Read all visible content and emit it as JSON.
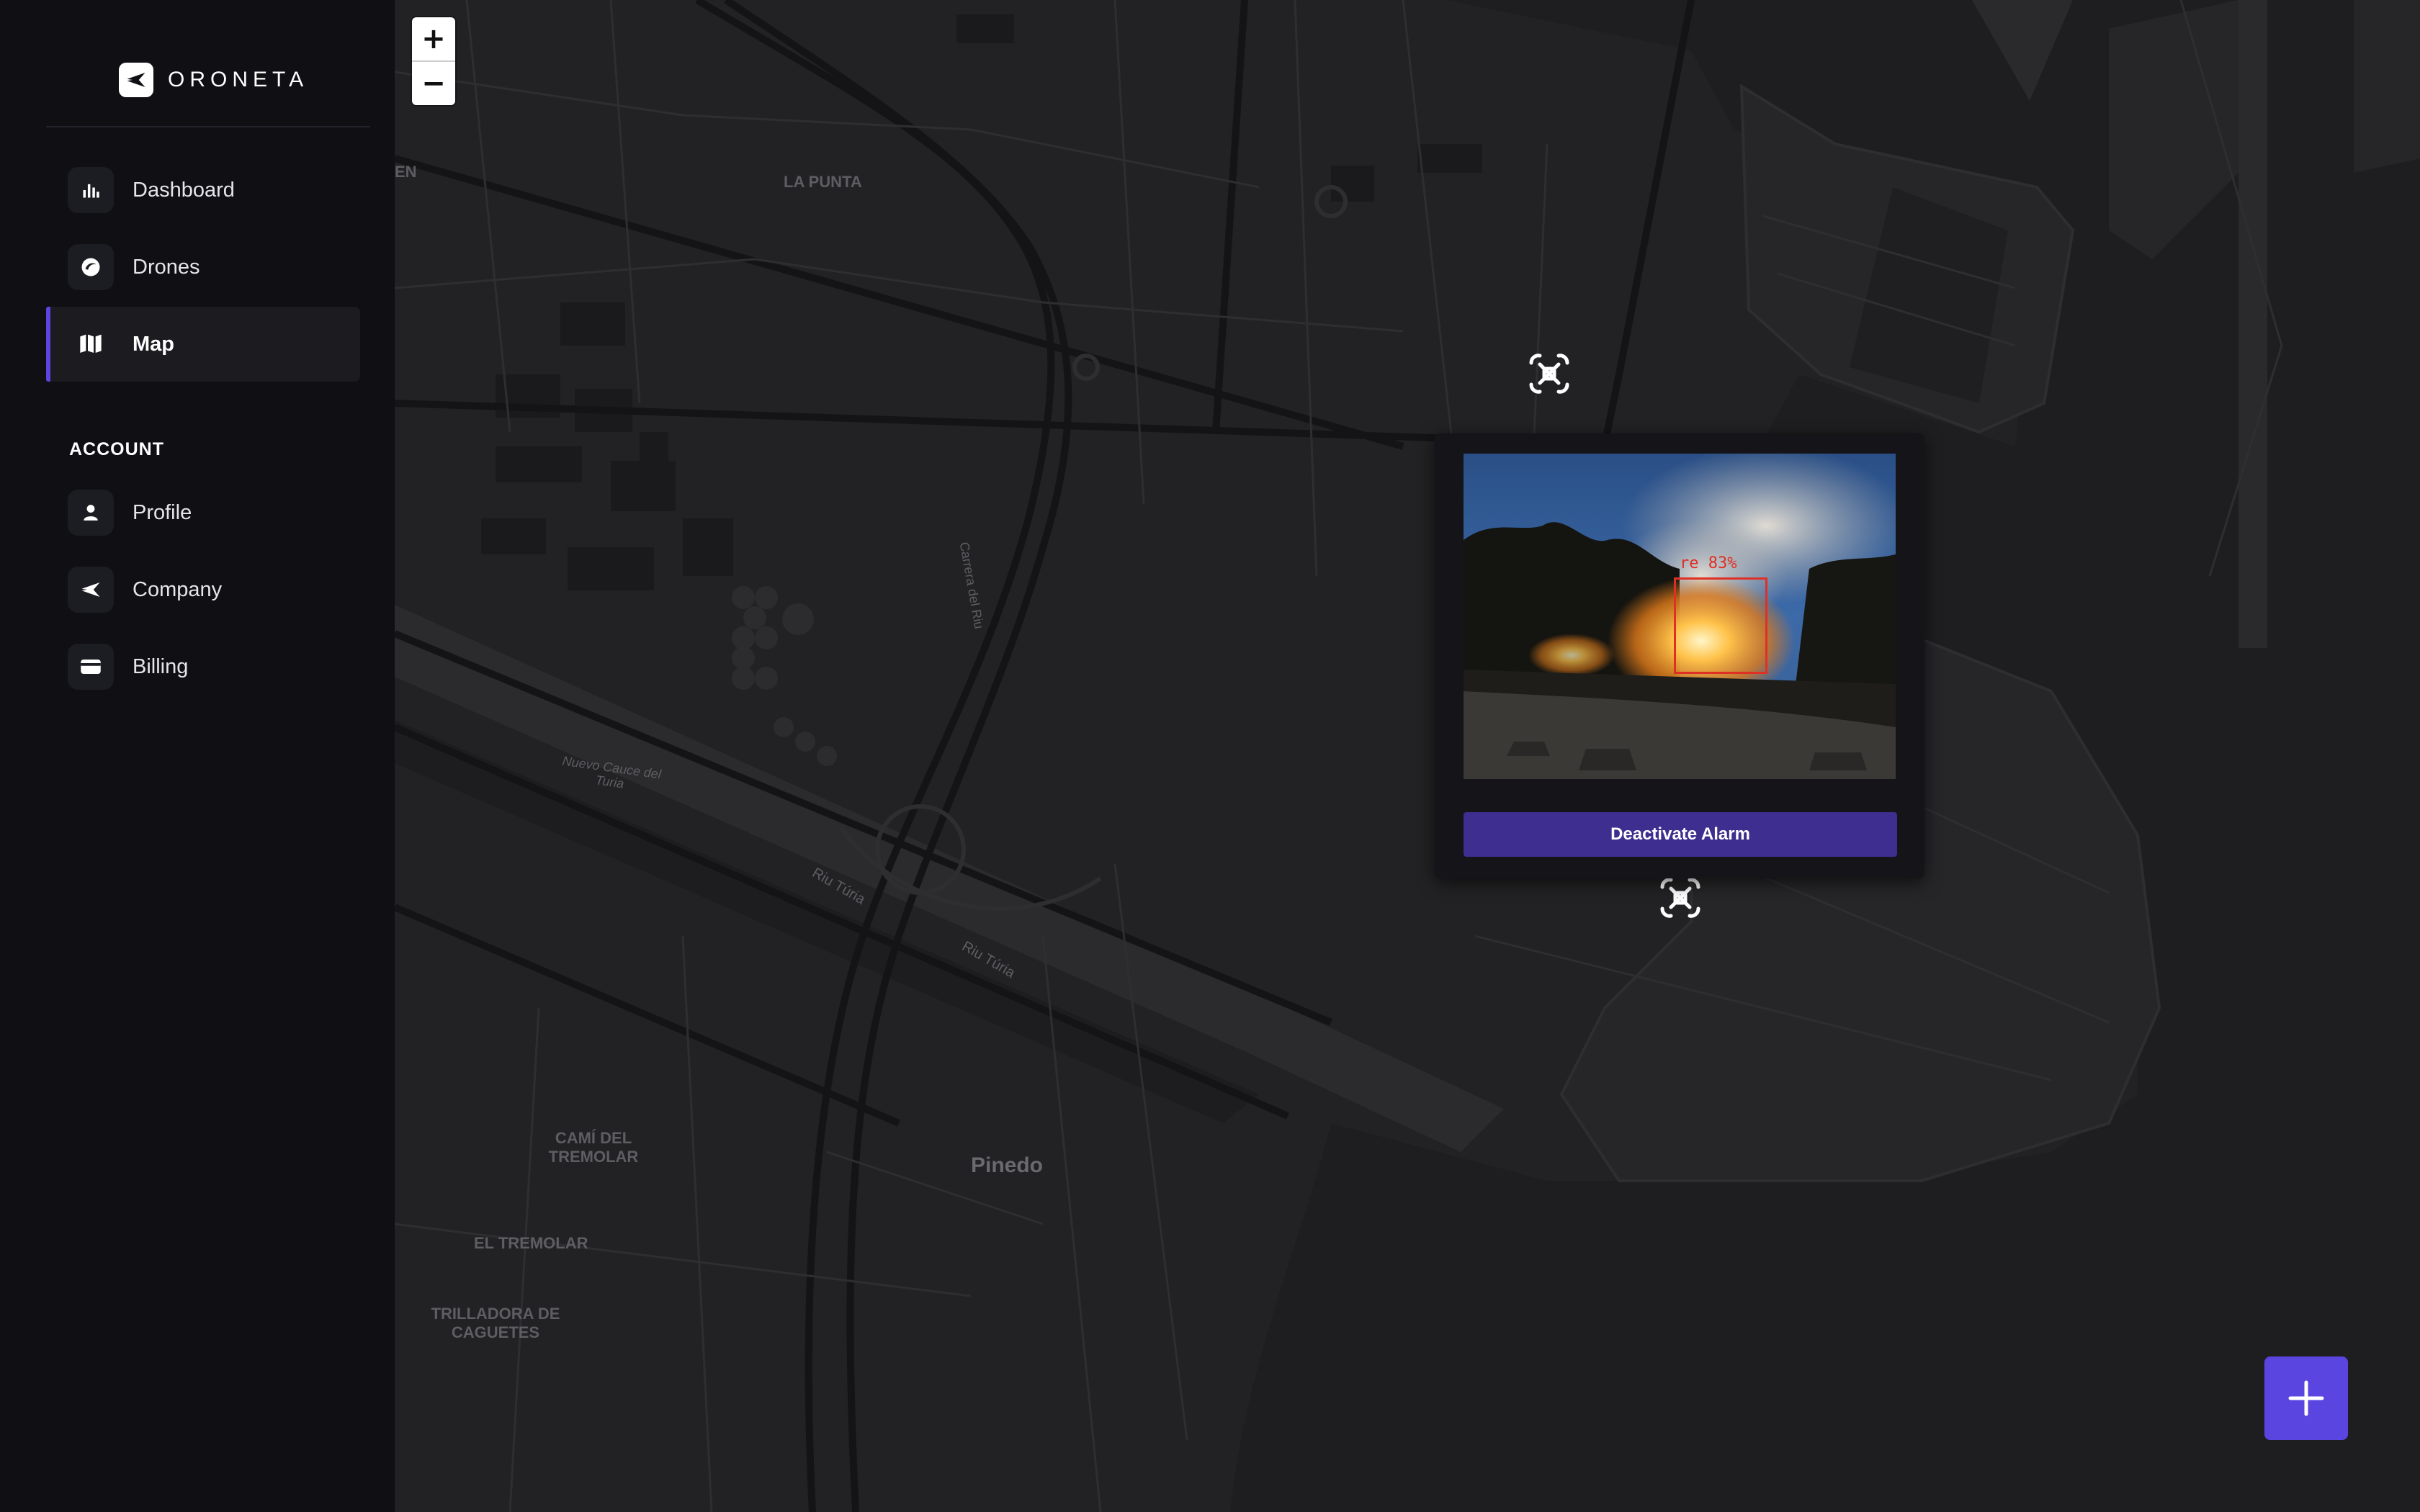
{
  "app": {
    "brand_name": "ORONETA",
    "accent_color": "#5a45e0",
    "logo_icon": "paper-plane-icon"
  },
  "sidebar": {
    "main_items": [
      {
        "label": "Dashboard",
        "icon": "bar-chart-icon",
        "active": false
      },
      {
        "label": "Drones",
        "icon": "drone-swirl-icon",
        "active": false
      },
      {
        "label": "Map",
        "icon": "map-icon",
        "active": true
      }
    ],
    "account_title": "ACCOUNT",
    "account_items": [
      {
        "label": "Profile",
        "icon": "user-icon"
      },
      {
        "label": "Company",
        "icon": "paper-plane-icon"
      },
      {
        "label": "Billing",
        "icon": "credit-card-icon"
      }
    ]
  },
  "map": {
    "zoom_in": "+",
    "zoom_out": "−",
    "labels": {
      "la_punta": "LA PUNTA",
      "en": "EN",
      "nuevo_cauce": "Nuevo Cauce del Turia",
      "riu_turia_1": "Riu Túria",
      "riu_turia_2": "Riu Túria",
      "pinedo": "Pinedo",
      "cami_del_tremolar": "CAMÍ DEL TREMOLAR",
      "el_tremolar": "EL TREMOLAR",
      "trilladora": "TRILLADORA DE CAGUETES",
      "carrera_del_riu": "Carrera del Riu"
    }
  },
  "alert_popup": {
    "detection_label": "re 83%",
    "detection_confidence": 0.83,
    "detection_color": "#e03026",
    "button_label": "Deactivate Alarm"
  },
  "fab": {
    "icon": "plus-icon"
  }
}
